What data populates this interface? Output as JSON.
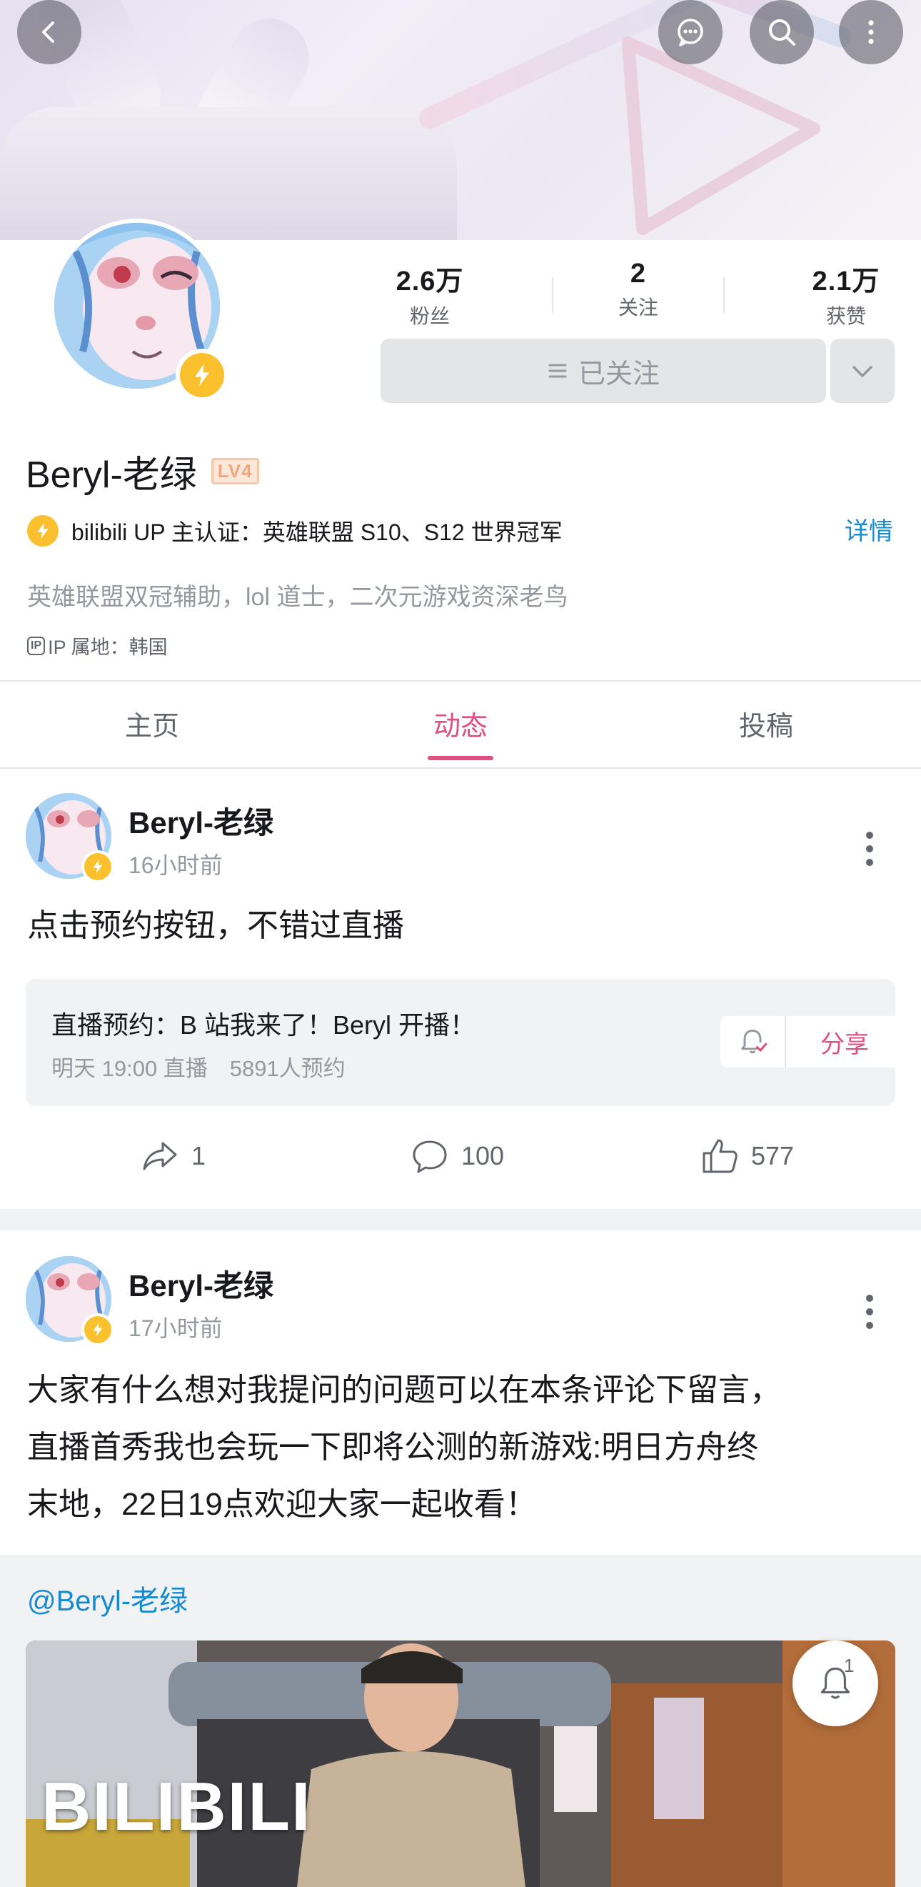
{
  "nav": {
    "back_icon": "chevron-left-icon",
    "message_icon": "chat-dots-icon",
    "search_icon": "search-icon",
    "more_icon": "vertical-dots-icon"
  },
  "profile": {
    "stats": [
      {
        "value": "2.6万",
        "label": "粉丝"
      },
      {
        "value": "2",
        "label": "关注"
      },
      {
        "value": "2.1万",
        "label": "获赞"
      }
    ],
    "follow_button": "已关注",
    "username": "Beryl-老绿",
    "level": "LV4",
    "certification": "bilibili UP 主认证：英雄联盟 S10、S12 世界冠军",
    "detail_link": "详情",
    "bio": "英雄联盟双冠辅助，lol 道士，二次元游戏资深老鸟",
    "ip_icon_text": "IP",
    "ip_location": "IP 属地：韩国"
  },
  "tabs": [
    {
      "label": "主页"
    },
    {
      "label": "动态"
    },
    {
      "label": "投稿"
    }
  ],
  "active_tab": "动态",
  "posts": [
    {
      "author": "Beryl-老绿",
      "time": "16小时前",
      "text": "点击预约按钮，不错过直播",
      "reservation": {
        "title": "直播预约：B 站我来了！Beryl 开播！",
        "meta": "明天 19:00 直播　5891人预约",
        "share_label": "分享"
      },
      "actions": {
        "forward": "1",
        "comment": "100",
        "like": "577"
      }
    },
    {
      "author": "Beryl-老绿",
      "time": "17小时前",
      "text_lines": [
        "大家有什么想对我提问的问题可以在本条评论下留言，",
        "直播首秀我也会玩一下即将公测的新游戏:明日方舟终",
        "末地，22日19点欢迎大家一起收看！"
      ],
      "repost_mention": "@Beryl-老绿",
      "video_label": "BILIBILI",
      "float_bell_count": "1"
    }
  ],
  "colors": {
    "accent_pink": "#e0507f",
    "link_blue": "#178bcf",
    "badge_yellow": "#fbc02d",
    "muted_gray": "#9499a0"
  }
}
